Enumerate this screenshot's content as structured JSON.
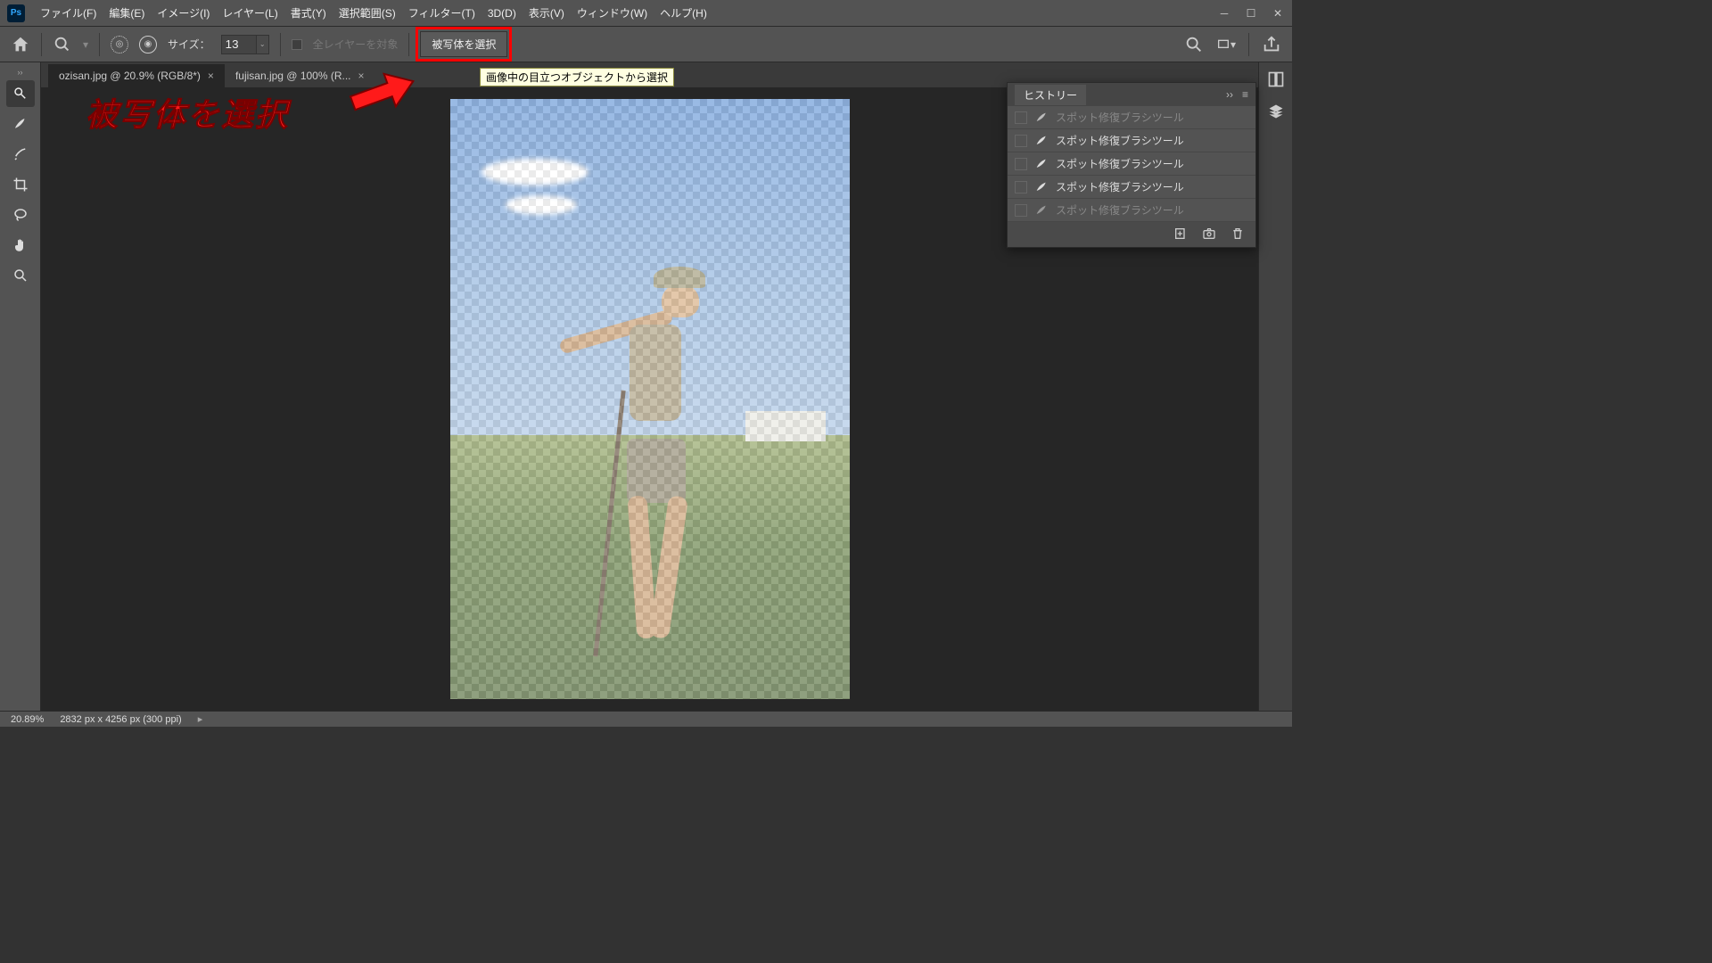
{
  "app": {
    "logo": "Ps"
  },
  "menus": [
    "ファイル(F)",
    "編集(E)",
    "イメージ(I)",
    "レイヤー(L)",
    "書式(Y)",
    "選択範囲(S)",
    "フィルター(T)",
    "3D(D)",
    "表示(V)",
    "ウィンドウ(W)",
    "ヘルプ(H)"
  ],
  "options": {
    "size_label": "サイズ：",
    "size_value": "13",
    "all_layers_label": "全レイヤーを対象",
    "select_subject": "被写体を選択",
    "tooltip": "画像中の目立つオブジェクトから選択"
  },
  "tabs": [
    {
      "label": "ozisan.jpg @ 20.9% (RGB/8*)",
      "active": true
    },
    {
      "label": "fujisan.jpg @ 100% (R...",
      "active": false
    }
  ],
  "history": {
    "title": "ヒストリー",
    "items": [
      {
        "label": "スポット修復ブラシツール",
        "dim": true
      },
      {
        "label": "スポット修復ブラシツール",
        "dim": false
      },
      {
        "label": "スポット修復ブラシツール",
        "dim": false
      },
      {
        "label": "スポット修復ブラシツール",
        "dim": false
      },
      {
        "label": "スポット修復ブラシツール",
        "dim": true
      }
    ]
  },
  "status": {
    "zoom": "20.89%",
    "dims": "2832 px x 4256 px (300 ppi)"
  },
  "annotation": {
    "text": "被写体を選択"
  }
}
